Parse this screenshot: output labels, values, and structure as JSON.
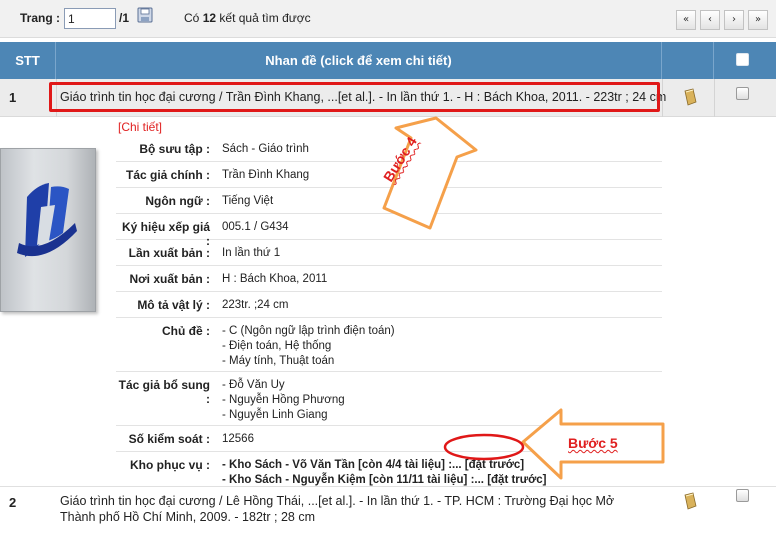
{
  "toolbar": {
    "page_label": "Trang :",
    "page_value": "1",
    "page_total": "/1",
    "result_prefix": "Có",
    "result_count": "12",
    "result_suffix": "kết quả tìm được",
    "pager": {
      "first": "«",
      "prev": "‹",
      "next": "›",
      "last": "»"
    }
  },
  "table": {
    "headers": {
      "stt": "STT",
      "title": "Nhan đề (click để xem chi tiết)"
    },
    "rows": [
      {
        "stt": "1",
        "title": "Giáo trình tin học đại cương / Trần Đình Khang, ...[et al.]. - In lần thứ 1. - H : Bách Khoa, 2011. - 223tr ; 24 cm"
      },
      {
        "stt": "2",
        "title": "Giáo trình tin học đại cương / Lê Hồng Thái, ...[et al.]. - In lần thứ 1. - TP. HCM : Trường Đại học Mở Thành phố Hồ Chí Minh, 2009. - 182tr ; 28 cm"
      }
    ]
  },
  "detail": {
    "link": "[Chi tiết]",
    "fields": [
      {
        "label": "Bộ sưu tập :",
        "values": [
          "Sách - Giáo trình"
        ]
      },
      {
        "label": "Tác giả chính :",
        "values": [
          "Trần Đình Khang"
        ]
      },
      {
        "label": "Ngôn ngữ :",
        "values": [
          "Tiếng Việt"
        ]
      },
      {
        "label": "Ký hiệu xếp giá :",
        "values": [
          "005.1 / G434"
        ]
      },
      {
        "label": "Lần xuất bản :",
        "values": [
          "In lần thứ 1"
        ]
      },
      {
        "label": "Nơi xuất bản :",
        "values": [
          "H : Bách Khoa, 2011"
        ]
      },
      {
        "label": "Mô tả vật lý :",
        "values": [
          "223tr. ;24 cm"
        ]
      },
      {
        "label": "Chủ đề :",
        "values": [
          "- C (Ngôn ngữ lập trình điện toán)",
          "- Điện toán, Hệ thống",
          "- Máy tính, Thuật toán"
        ]
      },
      {
        "label": "Tác giả bổ sung :",
        "values": [
          "- Đỗ Văn Uy",
          "- Nguyễn Hồng Phương",
          "- Nguyễn Linh Giang"
        ]
      },
      {
        "label": "Số kiểm soát :",
        "values": [
          "12566"
        ]
      },
      {
        "label": "Kho phục vụ :",
        "values": [
          "- Kho Sách - Võ Văn Tần [còn 4/4 tài liệu] :... [đặt trước]",
          "- Kho Sách - Nguyễn Kiệm [còn 11/11 tài liệu] :... [đặt trước]"
        ]
      }
    ]
  },
  "annotations": {
    "step4": "Bước 4",
    "step5": "Bước 5"
  },
  "colors": {
    "header_bg": "#4d86b5",
    "highlight_red": "#e01818",
    "arrow_orange": "#f5a04a"
  },
  "icons": [
    "save-icon",
    "book-icon",
    "checkbox",
    "logo-icon"
  ]
}
